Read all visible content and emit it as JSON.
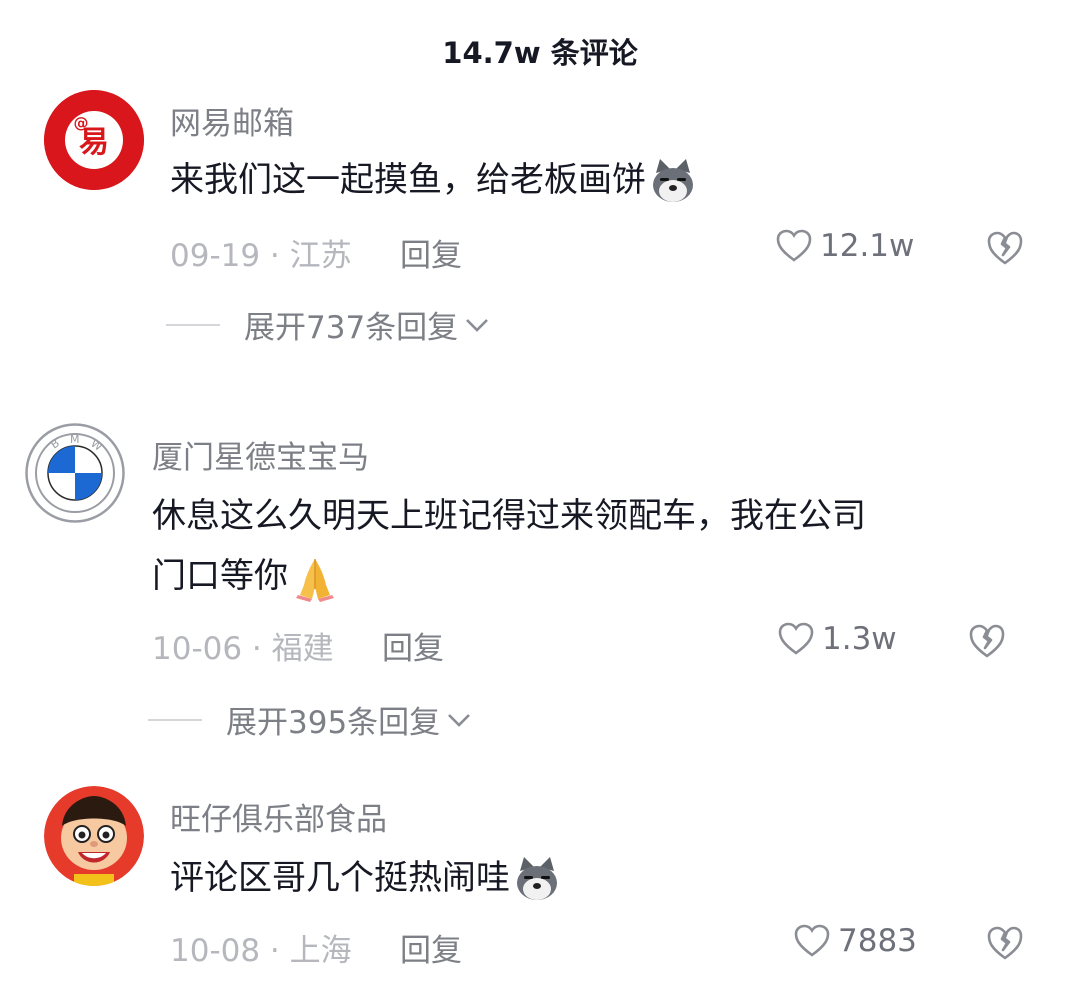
{
  "header": {
    "title": "14.7w 条评论"
  },
  "comments": [
    {
      "user": "网易邮箱",
      "text_lines": [
        "来我们这一起摸鱼，给老板画饼"
      ],
      "emoji": "dog-emoji",
      "date_location": "09-19 · 江苏",
      "reply_label": "回复",
      "likes": "12.1w",
      "expand_label": "展开737条回复",
      "avatar_text": "@易",
      "avatar_color": "#d8161b"
    },
    {
      "user": "厦门星德宝宝马",
      "text_lines": [
        "休息这么久明天上班记得过来领配车，我在公司",
        "门口等你"
      ],
      "emoji": "pray-emoji",
      "date_location": "10-06 · 福建",
      "reply_label": "回复",
      "likes": "1.3w",
      "expand_label": "展开395条回复",
      "avatar_text": "B M W",
      "avatar_color": "#1c69d4"
    },
    {
      "user": "旺仔俱乐部食品",
      "text_lines": [
        "评论区哥几个挺热闹哇"
      ],
      "emoji": "dog-emoji",
      "date_location": "10-08 · 上海",
      "reply_label": "回复",
      "likes": "7883",
      "avatar_color": "#e63a2b"
    }
  ]
}
